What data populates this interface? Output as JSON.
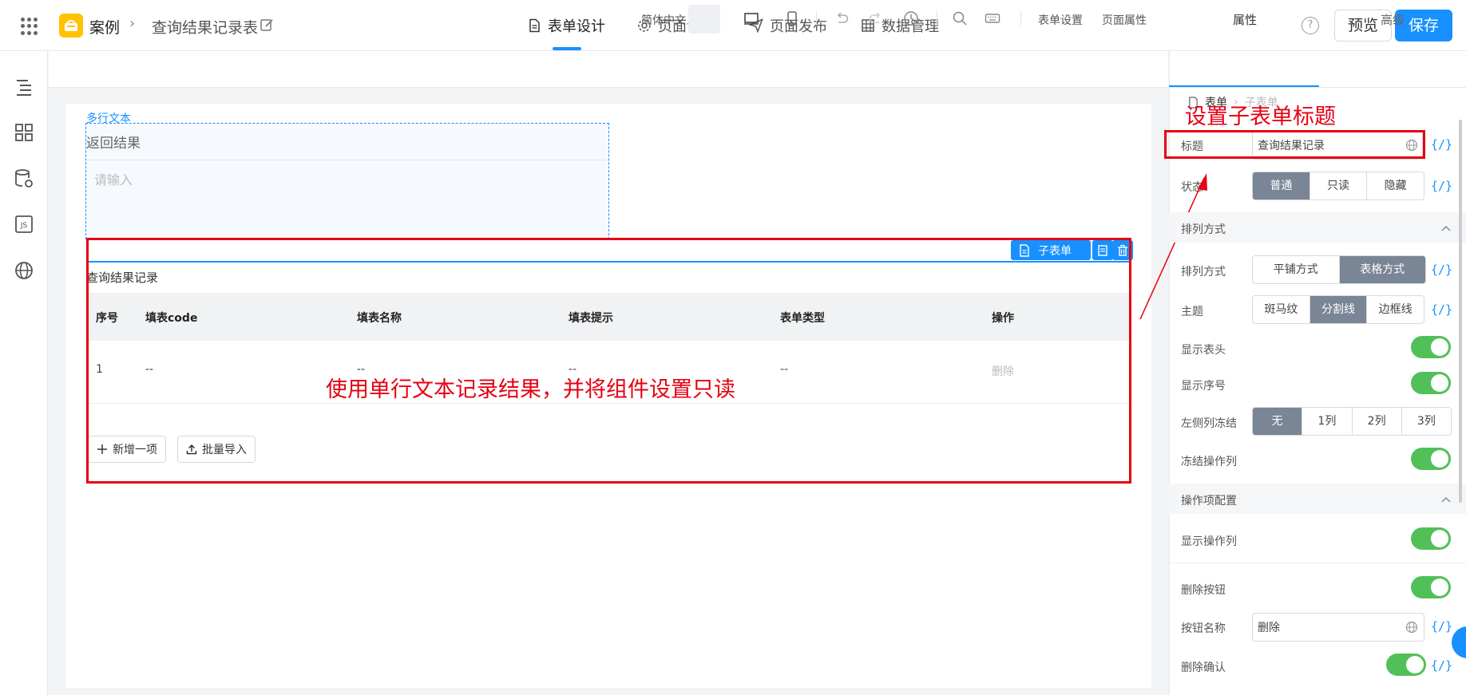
{
  "header": {
    "app_name": "案例",
    "breadcrumb_sep": "›",
    "page_name": "查询结果记录表",
    "tabs": [
      {
        "label": "表单设计",
        "icon": "document-icon"
      },
      {
        "label": "页面设置",
        "icon": "gear-icon"
      },
      {
        "label": "页面发布",
        "icon": "send-icon"
      },
      {
        "label": "数据管理",
        "icon": "grid-icon"
      }
    ],
    "help": "?",
    "preview_label": "预览",
    "save_label": "保存",
    "accent_color": "#1890ff",
    "logo_color": "#ffc200"
  },
  "toolbar": {
    "language": "简体中文",
    "form_settings": "表单设置",
    "page_props": "页面属性"
  },
  "canvas": {
    "multiline": {
      "component_label": "多行文本",
      "title": "返回结果",
      "placeholder": "请输入"
    },
    "subform": {
      "tag": "子表单",
      "title": "查询结果记录",
      "columns": [
        "序号",
        "填表code",
        "填表名称",
        "填表提示",
        "表单类型",
        "操作"
      ],
      "rows": [
        {
          "index": "1",
          "code": "--",
          "name": "--",
          "hint": "--",
          "type": "--",
          "action": "删除"
        }
      ],
      "add_button": "新增一项",
      "import_button": "批量导入"
    },
    "annotation_main": "使用单行文本记录结果，并将组件设置只读",
    "annotation_title": "设置子表单标题",
    "annotation_color": "#e60012"
  },
  "panel": {
    "tabs": [
      "属性",
      "高级"
    ],
    "breadcrumb": [
      "表单",
      "子表单"
    ],
    "code_tag": "{/}",
    "title_label": "标题",
    "title_value": "查询结果记录",
    "status_label": "状态",
    "status_options": [
      "普通",
      "只读",
      "隐藏"
    ],
    "layout_section": "排列方式",
    "layout_label": "排列方式",
    "layout_options": [
      "平铺方式",
      "表格方式"
    ],
    "theme_label": "主题",
    "theme_options": [
      "斑马纹",
      "分割线",
      "边框线"
    ],
    "show_header_label": "显示表头",
    "show_index_label": "显示序号",
    "freeze_left_label": "左侧列冻结",
    "freeze_options": [
      "无",
      "1列",
      "2列",
      "3列"
    ],
    "freeze_action_label": "冻结操作列",
    "action_section": "操作项配置",
    "show_action_label": "显示操作列",
    "delete_button_label": "删除按钮",
    "button_name_label": "按钮名称",
    "button_name_value": "删除",
    "delete_confirm_label": "删除确认",
    "toggle_color": "#52c058",
    "segment_active_color": "#7a8596"
  }
}
